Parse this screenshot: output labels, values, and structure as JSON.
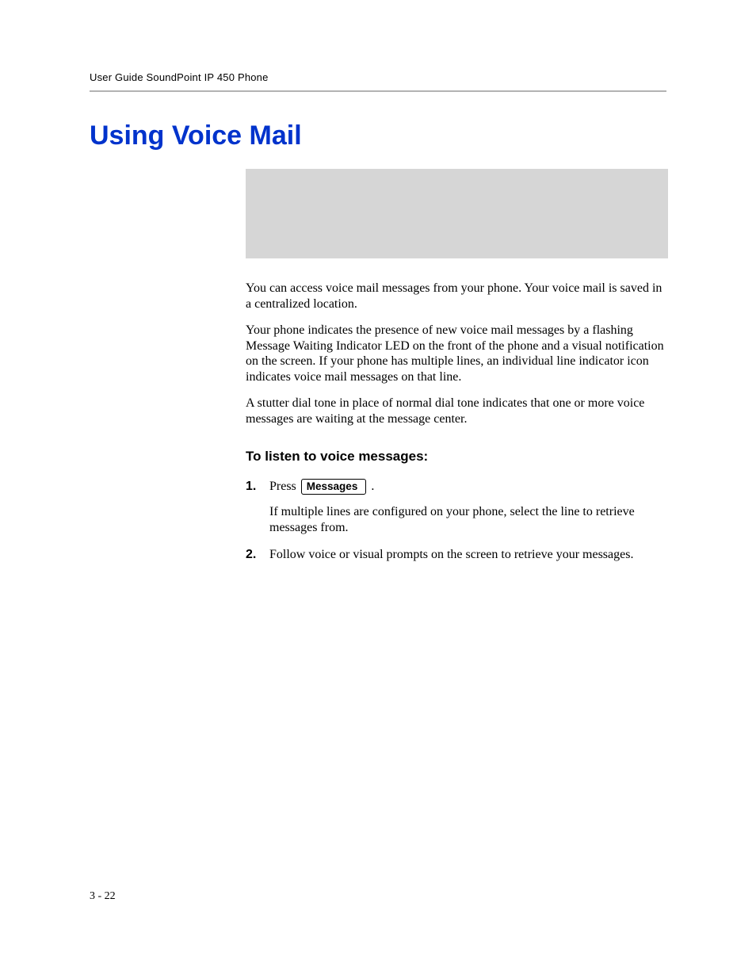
{
  "header": {
    "running_head": "User Guide SoundPoint IP 450 Phone"
  },
  "title": "Using Voice Mail",
  "paragraphs": {
    "p1": "You can access voice mail messages from your phone. Your voice mail is saved in a centralized location.",
    "p2": "Your phone indicates the presence of new voice mail messages by a flashing Message Waiting Indicator LED on the front of the phone and a visual notification on the screen. If your phone has multiple lines, an individual line indicator icon indicates voice mail messages on that line.",
    "p3": "A stutter dial tone in place of normal dial tone indicates that one or more voice messages are waiting at the message center."
  },
  "subhead": "To listen to voice messages:",
  "steps": {
    "s1_press": "Press",
    "s1_button": "Messages",
    "s1_after": ".",
    "s1_sub": "If multiple lines are configured on your phone, select the line to retrieve messages from.",
    "s2": "Follow voice or visual prompts on the screen to retrieve your messages."
  },
  "footer": {
    "page": "3 - 22"
  }
}
